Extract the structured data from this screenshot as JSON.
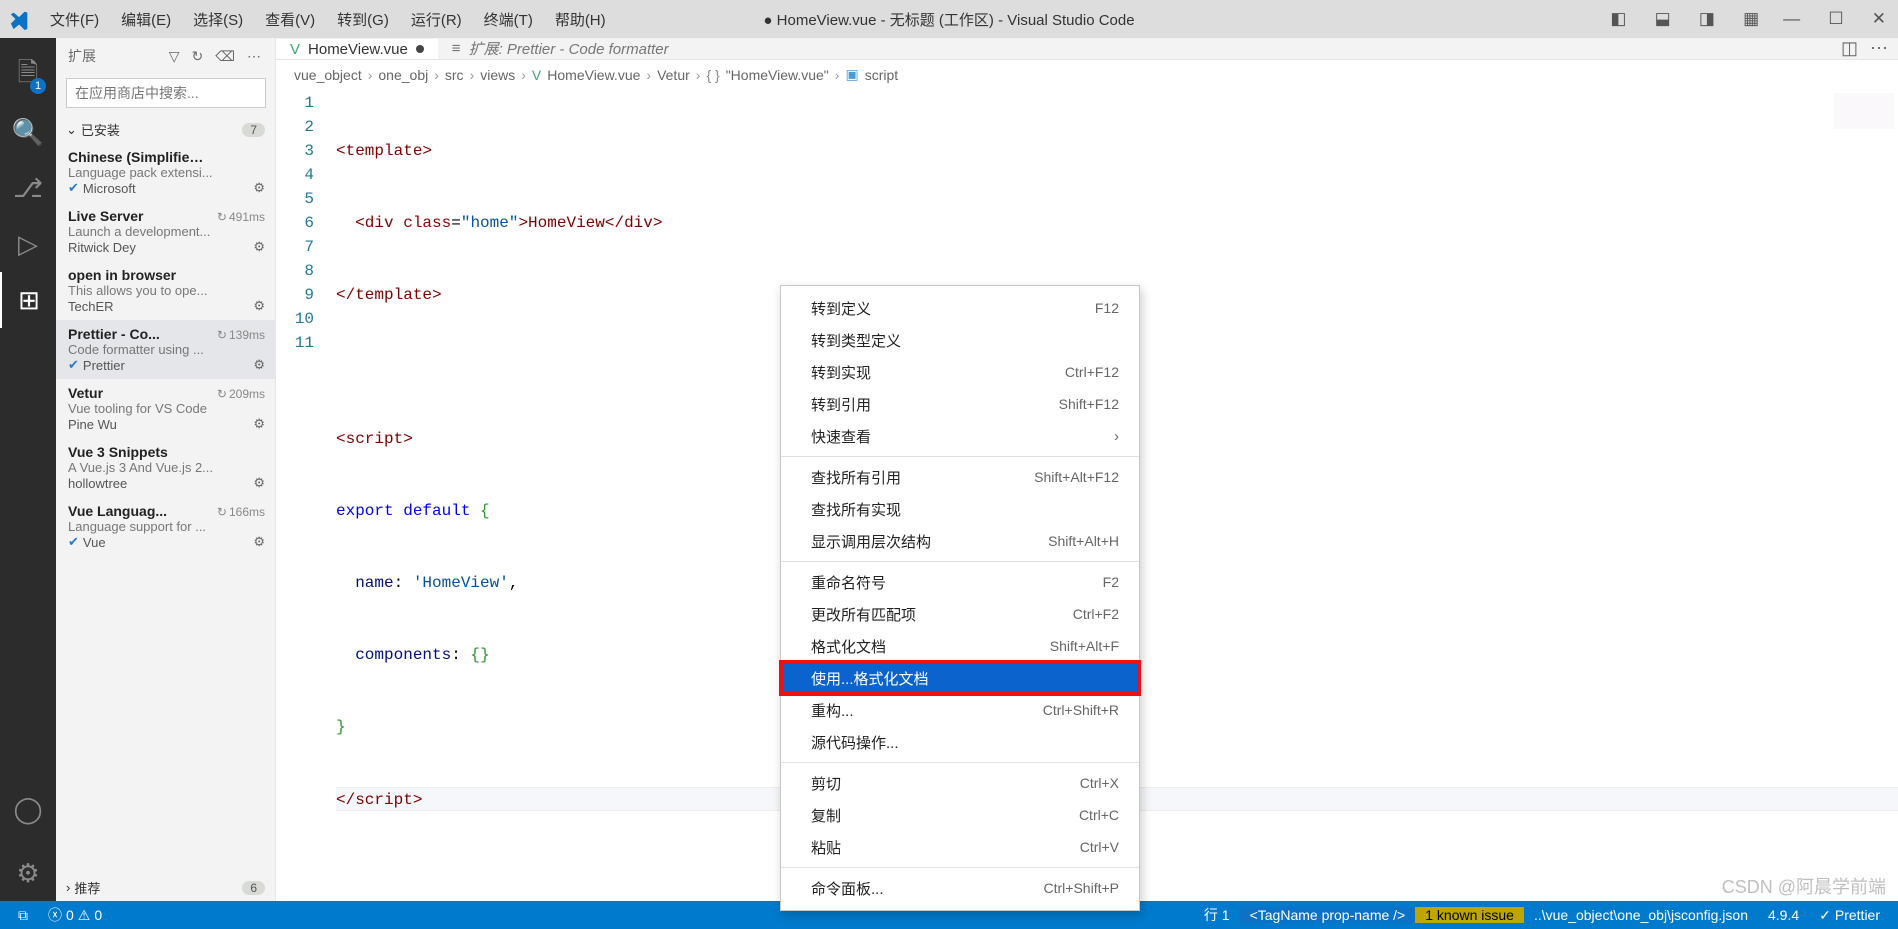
{
  "title": "● HomeView.vue - 无标题 (工作区) - Visual Studio Code",
  "menu": [
    "文件(F)",
    "编辑(E)",
    "选择(S)",
    "查看(V)",
    "转到(G)",
    "运行(R)",
    "终端(T)",
    "帮助(H)"
  ],
  "activity_badge": "1",
  "sidebar": {
    "title": "扩展",
    "search_placeholder": "在应用商店中搜索...",
    "installed": {
      "label": "已安装",
      "count": "7"
    },
    "recommended": {
      "label": "推荐",
      "count": "6"
    }
  },
  "extensions": [
    {
      "name": "Chinese (Simplified) (...",
      "desc": "Language pack extensi...",
      "pub": "Microsoft",
      "verified": true,
      "time": ""
    },
    {
      "name": "Live Server",
      "desc": "Launch a development...",
      "pub": "Ritwick Dey",
      "verified": false,
      "time": "491ms"
    },
    {
      "name": "open in browser",
      "desc": "This allows you to ope...",
      "pub": "TechER",
      "verified": false,
      "time": ""
    },
    {
      "name": "Prettier - Co...",
      "desc": "Code formatter using ...",
      "pub": "Prettier",
      "verified": true,
      "time": "139ms",
      "selected": true
    },
    {
      "name": "Vetur",
      "desc": "Vue tooling for VS Code",
      "pub": "Pine Wu",
      "verified": false,
      "time": "209ms"
    },
    {
      "name": "Vue 3 Snippets",
      "desc": "A Vue.js 3 And Vue.js 2...",
      "pub": "hollowtree",
      "verified": false,
      "time": ""
    },
    {
      "name": "Vue Languag...",
      "desc": "Language support for ...",
      "pub": "Vue",
      "verified": true,
      "time": "166ms"
    }
  ],
  "tabs": {
    "active": {
      "icon": "V",
      "label": "HomeView.vue"
    },
    "other": {
      "label": "扩展: Prettier - Code formatter"
    }
  },
  "breadcrumbs": [
    "vue_object",
    "one_obj",
    "src",
    "views",
    "HomeView.vue",
    "Vetur",
    "\"HomeView.vue\"",
    "script"
  ],
  "code": {
    "lines": [
      "1",
      "2",
      "3",
      "4",
      "5",
      "6",
      "7",
      "8",
      "9",
      "10",
      "11"
    ],
    "l1a": "<template>",
    "l2a": "  <div ",
    "l2b": "class",
    "l2c": "=",
    "l2d": "\"home\"",
    "l2e": ">HomeView</div>",
    "l3a": "</template>",
    "l5a": "<script>",
    "l6a": "export",
    "l6b": " default",
    "l6c": " {",
    "l7a": "  name",
    "l7b": ": ",
    "l7c": "'HomeView'",
    "l7d": ",",
    "l8a": "  components",
    "l8b": ": ",
    "l8c": "{}",
    "l9a": "}",
    "l10a": "</script>"
  },
  "context_menu": [
    {
      "label": "转到定义",
      "shortcut": "F12"
    },
    {
      "label": "转到类型定义",
      "shortcut": ""
    },
    {
      "label": "转到实现",
      "shortcut": "Ctrl+F12"
    },
    {
      "label": "转到引用",
      "shortcut": "Shift+F12"
    },
    {
      "label": "快速查看",
      "shortcut": "",
      "sub": true
    },
    {
      "sep": true
    },
    {
      "label": "查找所有引用",
      "shortcut": "Shift+Alt+F12"
    },
    {
      "label": "查找所有实现",
      "shortcut": ""
    },
    {
      "label": "显示调用层次结构",
      "shortcut": "Shift+Alt+H"
    },
    {
      "sep": true
    },
    {
      "label": "重命名符号",
      "shortcut": "F2"
    },
    {
      "label": "更改所有匹配项",
      "shortcut": "Ctrl+F2"
    },
    {
      "label": "格式化文档",
      "shortcut": "Shift+Alt+F"
    },
    {
      "label": "使用...格式化文档",
      "shortcut": "",
      "hi": true,
      "boxed": true
    },
    {
      "label": "重构...",
      "shortcut": "Ctrl+Shift+R"
    },
    {
      "label": "源代码操作...",
      "shortcut": ""
    },
    {
      "sep": true
    },
    {
      "label": "剪切",
      "shortcut": "Ctrl+X"
    },
    {
      "label": "复制",
      "shortcut": "Ctrl+C"
    },
    {
      "label": "粘贴",
      "shortcut": "Ctrl+V"
    },
    {
      "sep": true
    },
    {
      "label": "命令面板...",
      "shortcut": "Ctrl+Shift+P"
    }
  ],
  "status": {
    "errors": "0",
    "warnings": "0",
    "line": "行 1",
    "tag": "<TagName prop-name />",
    "issue": "1 known issue",
    "path": "..\\vue_object\\one_obj\\jsconfig.json",
    "ver": "4.9.4",
    "prettier": "Prettier"
  },
  "watermark": "CSDN @阿晨学前端"
}
